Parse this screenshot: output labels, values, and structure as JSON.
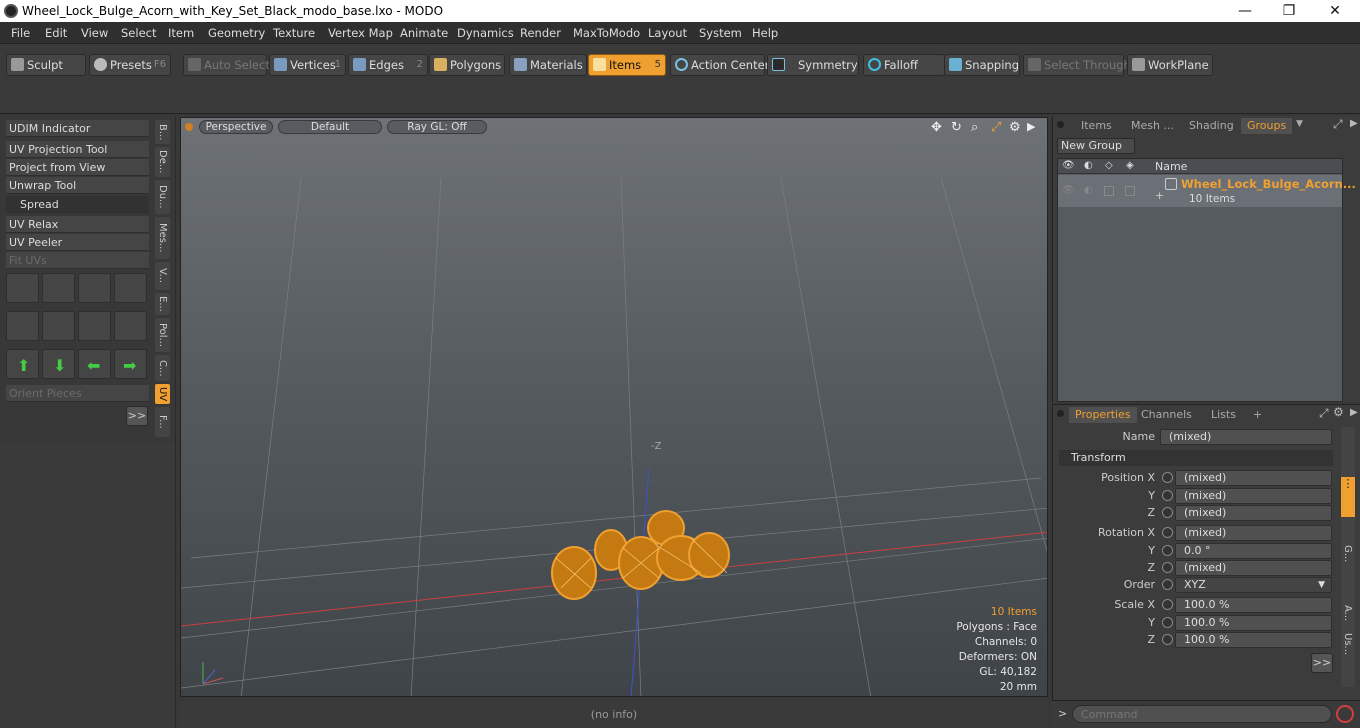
{
  "window": {
    "title": "Wheel_Lock_Bulge_Acorn_with_Key_Set_Black_modo_base.lxo - MODO",
    "min": "—",
    "max": "❐",
    "close": "✕"
  },
  "menu": [
    "File",
    "Edit",
    "View",
    "Select",
    "Item",
    "Geometry",
    "Texture",
    "Vertex Map",
    "Animate",
    "Dynamics",
    "Render",
    "MaxToModo",
    "Layout",
    "System",
    "Help"
  ],
  "toolbar": {
    "sculpt": "Sculpt",
    "presets": "Presets",
    "presets_key": "F6",
    "auto_select": "Auto Select",
    "vertices": "Vertices",
    "vertices_num": "1",
    "edges": "Edges",
    "edges_num": "2",
    "polygons": "Polygons",
    "materials": "Materials",
    "items": "Items",
    "items_num": "5",
    "action_center": "Action Center",
    "symmetry": "Symmetry",
    "falloff": "Falloff",
    "snapping": "Snapping",
    "select_through": "Select Through",
    "workplane": "WorkPlane"
  },
  "left": {
    "buttons": [
      "UDIM Indicator",
      "UV Projection Tool",
      "Project from View",
      "Unwrap Tool",
      "Spread",
      "UV Relax",
      "UV Peeler",
      "Fit UVs"
    ],
    "orient": "Orient Pieces",
    "more": ">>",
    "vtabs": [
      "B...",
      "De...",
      "Du...",
      "Mes...",
      "V...",
      "E...",
      "Pol...",
      "C...",
      "UV",
      "F..."
    ]
  },
  "viewport": {
    "view": "Perspective",
    "shading": "Default",
    "raygl": "Ray GL: Off",
    "axis_label": "-Z",
    "stats": [
      "10 Items",
      "Polygons : Face",
      "Channels: 0",
      "Deformers: ON",
      "GL: 40,182",
      "20 mm"
    ]
  },
  "status": "(no info)",
  "groups": {
    "tabs": [
      "Items",
      "Mesh ...",
      "Shading",
      "Groups"
    ],
    "new_group": "New Group",
    "col_name": "Name",
    "item_name": "Wheel_Lock_Bulge_Acorn...",
    "item_count": "10 Items"
  },
  "props": {
    "tabs": [
      "Properties",
      "Channels",
      "Lists",
      "+"
    ],
    "name_label": "Name",
    "name_val": "(mixed)",
    "transform": "Transform",
    "rows": [
      {
        "label": "Position X",
        "val": "(mixed)"
      },
      {
        "label": "Y",
        "val": "(mixed)"
      },
      {
        "label": "Z",
        "val": "(mixed)"
      },
      {
        "label": "Rotation X",
        "val": "(mixed)"
      },
      {
        "label": "Y",
        "val": "0.0 °"
      },
      {
        "label": "Z",
        "val": "(mixed)"
      },
      {
        "label": "Order",
        "val": "XYZ"
      },
      {
        "label": "Scale X",
        "val": "100.0 %"
      },
      {
        "label": "Y",
        "val": "100.0 %"
      },
      {
        "label": "Z",
        "val": "100.0 %"
      }
    ],
    "more": ">>",
    "side_tabs": [
      "G...",
      "A...",
      "Us..."
    ]
  },
  "command": {
    "prompt": ">",
    "placeholder": "Command"
  }
}
